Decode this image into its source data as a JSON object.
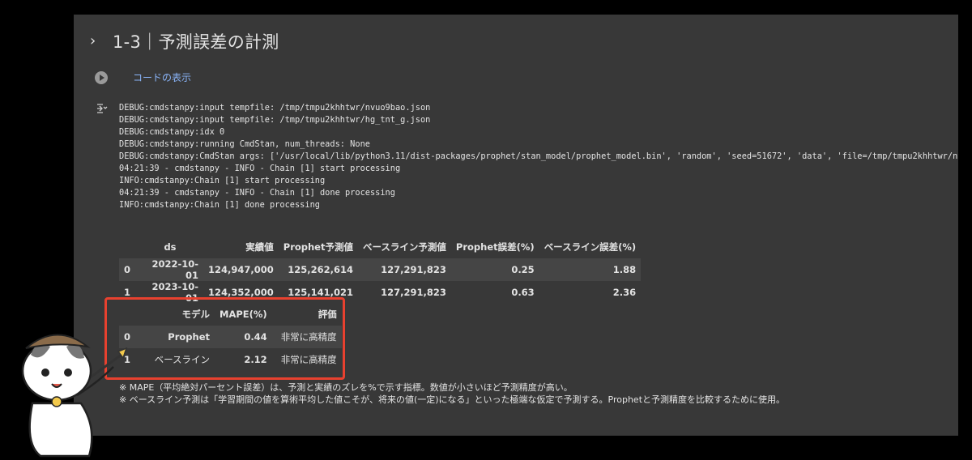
{
  "section": {
    "title": "1-3｜予測誤差の計測"
  },
  "code_cell": {
    "show_code_label": "コードの表示"
  },
  "log_lines": [
    "DEBUG:cmdstanpy:input tempfile: /tmp/tmpu2khhtwr/nvuo9bao.json",
    "DEBUG:cmdstanpy:input tempfile: /tmp/tmpu2khhtwr/hg_tnt_g.json",
    "DEBUG:cmdstanpy:idx 0",
    "DEBUG:cmdstanpy:running CmdStan, num_threads: None",
    "DEBUG:cmdstanpy:CmdStan args: ['/usr/local/lib/python3.11/dist-packages/prophet/stan_model/prophet_model.bin', 'random', 'seed=51672', 'data', 'file=/tmp/tmpu2khhtwr/nvuo9",
    "04:21:39 - cmdstanpy - INFO - Chain [1] start processing",
    "INFO:cmdstanpy:Chain [1] start processing",
    "04:21:39 - cmdstanpy - INFO - Chain [1] done processing",
    "INFO:cmdstanpy:Chain [1] done processing"
  ],
  "forecast_table": {
    "headers": [
      "",
      "ds",
      "実績値",
      "Prophet予測値",
      "ベースライン予測値",
      "Prophet誤差(%)",
      "ベースライン誤差(%)"
    ],
    "rows": [
      [
        "0",
        "2022-10-01",
        "124,947,000",
        "125,262,614",
        "127,291,823",
        "0.25",
        "1.88"
      ],
      [
        "1",
        "2023-10-01",
        "124,352,000",
        "125,141,021",
        "127,291,823",
        "0.63",
        "2.36"
      ]
    ]
  },
  "mape_table": {
    "headers": [
      "",
      "モデル",
      "MAPE(%)",
      "評価"
    ],
    "rows": [
      [
        "0",
        "Prophet",
        "0.44",
        "非常に高精度"
      ],
      [
        "1",
        "ベースライン",
        "2.12",
        "非常に高精度"
      ]
    ]
  },
  "notes": [
    "※ MAPE（平均絶対パーセント誤差）は、予測と実績のズレを%で示す指標。数値が小さいほど予測精度が高い。",
    "※ ベースライン予測は「学習期間の値を算術平均した値こそが、将来の値(一定)になる」といった極端な仮定で予測する。Prophetと予測精度を比較するために使用。"
  ],
  "colors": {
    "highlight": "#e8412f",
    "link": "#8ab4f8",
    "panel": "#383838"
  }
}
